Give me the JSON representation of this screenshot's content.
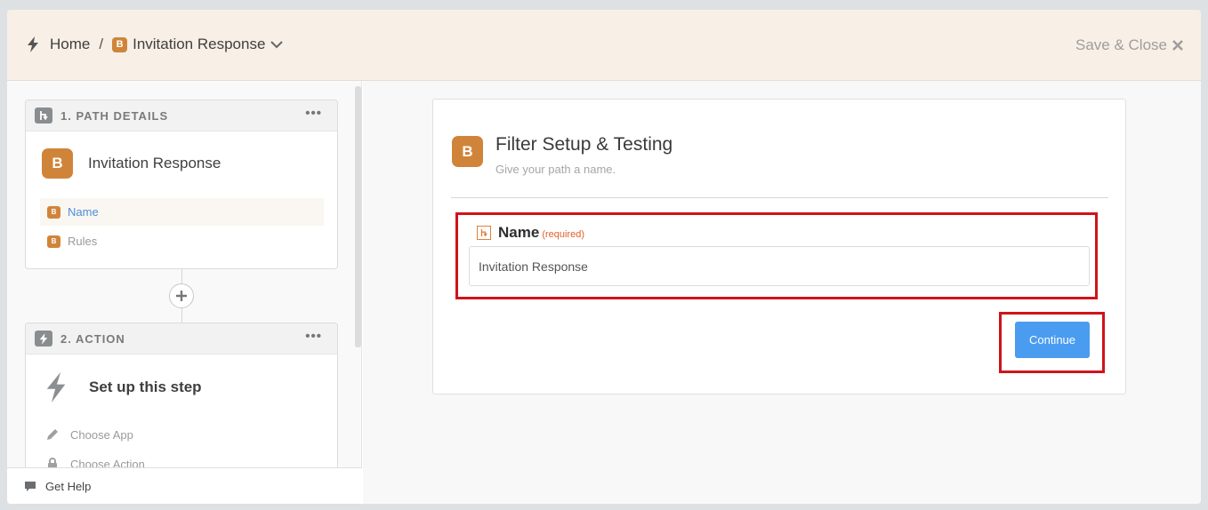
{
  "header": {
    "home_label": "Home",
    "separator": "/",
    "badge_letter": "B",
    "path_name": "Invitation Response",
    "save_close_label": "Save & Close"
  },
  "sidebar": {
    "card1": {
      "title": "1. PATH DETAILS",
      "menu": "•••",
      "badge_letter": "B",
      "name": "Invitation Response",
      "items": [
        {
          "badge": "B",
          "label": "Name",
          "active": true
        },
        {
          "badge": "B",
          "label": "Rules",
          "active": false
        }
      ]
    },
    "card2": {
      "title": "2. ACTION",
      "menu": "•••",
      "name": "Set up this step",
      "items": [
        {
          "label": "Choose App",
          "icon": "pencil-icon"
        },
        {
          "label": "Choose Action",
          "icon": "lock-icon"
        }
      ]
    },
    "help_label": "Get Help"
  },
  "panel": {
    "badge_letter": "B",
    "title": "Filter Setup & Testing",
    "subtitle": "Give your path a name.",
    "field": {
      "label": "Name",
      "required_text": "(required)",
      "value": "Invitation Response"
    },
    "continue_label": "Continue"
  },
  "colors": {
    "accent_orange": "#d0843a",
    "primary_blue": "#4a9cf0",
    "highlight_red": "#d0131a",
    "header_bg": "#f8efe6"
  }
}
